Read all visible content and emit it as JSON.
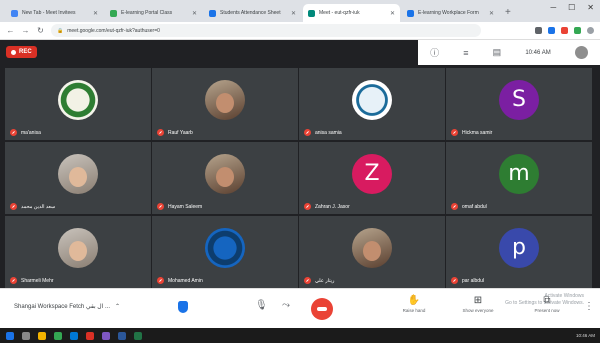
{
  "browser": {
    "tabs": [
      {
        "label": "New Tab - Meet Invitees",
        "color": "#4285f4",
        "active": false
      },
      {
        "label": "E-learning Portal Class",
        "color": "#34a853",
        "active": false
      },
      {
        "label": "Students Attendance Sheet",
        "color": "#1a73e8",
        "active": false
      },
      {
        "label": "Meet - eut-qzfr-iuk",
        "color": "#00897b",
        "active": true
      },
      {
        "label": "E-learning Workplace Form",
        "color": "#1a73e8",
        "active": false
      }
    ],
    "new_tab_symbol": "+",
    "url": "meet.google.com/eut-qzfr-iuk?authuser=0"
  },
  "meet": {
    "rec_label": "REC",
    "time": "10:46 AM",
    "participants": [
      {
        "name": "ma'anisa",
        "kind": "emblem"
      },
      {
        "name": "Rauf Yaarb",
        "kind": "photo-hijab"
      },
      {
        "name": "anisa samia",
        "kind": "logo-round"
      },
      {
        "name": "Hickma samir",
        "kind": "letter",
        "letter": "S",
        "color": "#7b1fa2"
      },
      {
        "name": "سعد الدين محمد",
        "kind": "photo-person"
      },
      {
        "name": "Hayam Saleem",
        "kind": "photo-hijab"
      },
      {
        "name": "Zahran J. Jasor",
        "kind": "letter",
        "letter": "Z",
        "color": "#d81b60"
      },
      {
        "name": "omaf abdul",
        "kind": "letter",
        "letter": "m",
        "color": "#2e7d32"
      },
      {
        "name": "Sharmeli Mehr",
        "kind": "photo-person"
      },
      {
        "name": "Mohamed Amin",
        "kind": "logo-m"
      },
      {
        "name": "ريتار علي",
        "kind": "photo-hijab"
      },
      {
        "name": "par albdul",
        "kind": "letter",
        "letter": "p",
        "color": "#3949ab"
      }
    ],
    "bottom": {
      "meeting_title": "Shangai Workspace Fetch ال بقي ...",
      "chevron": "⌃",
      "raise_hand": "Raise hand",
      "participants": "Show everyone",
      "present": "Present now",
      "watermark_line1": "Activate Windows",
      "watermark_line2": "Go to Settings to activate Windows."
    },
    "clock": "10:46 AM"
  }
}
